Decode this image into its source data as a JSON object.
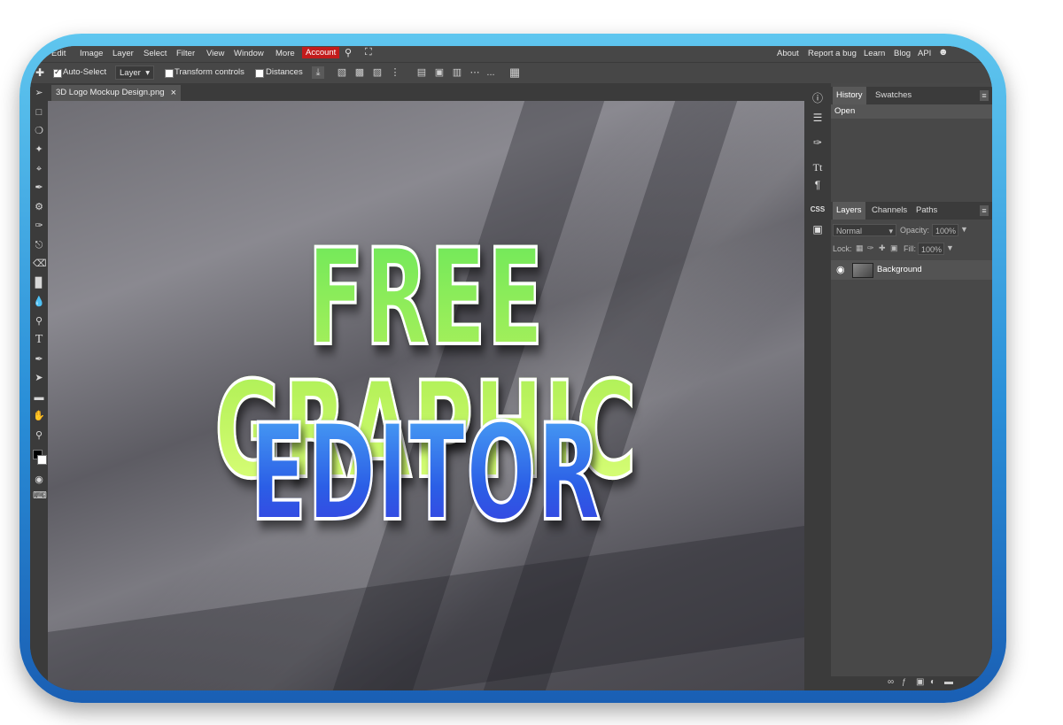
{
  "menubar": {
    "items": [
      "Edit",
      "Image",
      "Layer",
      "Select",
      "Filter",
      "View",
      "Window",
      "More"
    ],
    "account": "Account",
    "right_items": [
      "About",
      "Report a bug",
      "Learn",
      "Blog",
      "API"
    ]
  },
  "toolbar": {
    "auto_select": "Auto-Select",
    "layer_select": "Layer",
    "transform_controls": "Transform controls",
    "distances": "Distances",
    "more": "..."
  },
  "document": {
    "tab_title": "3D Logo Mockup Design.png",
    "close": "×"
  },
  "canvas": {
    "line1": "FREE GRAPHIC",
    "line2": "EDITOR"
  },
  "iconstrip": {
    "css_label": "CSS"
  },
  "history_panel": {
    "tabs": [
      "History",
      "Swatches"
    ],
    "entries": [
      "Open"
    ]
  },
  "layers_panel": {
    "tabs": [
      "Layers",
      "Channels",
      "Paths"
    ],
    "blend_mode": "Normal",
    "opacity_label": "Opacity:",
    "opacity_value": "100%",
    "lock_label": "Lock:",
    "fill_label": "Fill:",
    "fill_value": "100%",
    "layers": [
      "Background"
    ]
  },
  "colors": {
    "accent_account": "#c21c1c",
    "frame_top": "#5fc6ef",
    "frame_bottom": "#1a5fb4",
    "text_green": "#9be84a",
    "text_blue": "#2b5ee6"
  }
}
